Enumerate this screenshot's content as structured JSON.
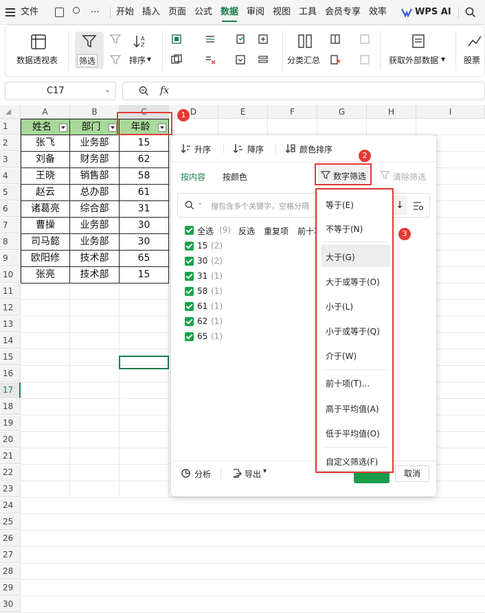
{
  "menubar": {
    "items": [
      "文件",
      "开始",
      "插入",
      "页面",
      "公式",
      "数据",
      "审阅",
      "视图",
      "工具",
      "会员专享",
      "效率"
    ],
    "active": "数据",
    "wps_ai": "WPS AI"
  },
  "ribbon": {
    "pivot": "数据透视表",
    "filter": "筛选",
    "sort": "排序",
    "subtotal": "分类汇总",
    "external": "获取外部数据",
    "stocks": "股票"
  },
  "formula_bar": {
    "cell_ref": "C17",
    "fx": "fx",
    "content": ""
  },
  "sheet": {
    "columns": [
      "A",
      "B",
      "C",
      "D",
      "E",
      "F",
      "G",
      "H",
      "I"
    ],
    "rows": [
      "1",
      "2",
      "3",
      "4",
      "5",
      "6",
      "7",
      "8",
      "9",
      "10",
      "11",
      "12",
      "13",
      "14",
      "15",
      "16",
      "17",
      "18",
      "19",
      "20",
      "21",
      "22",
      "23",
      "24",
      "25",
      "26",
      "27",
      "28",
      "29",
      "30"
    ],
    "header": [
      "姓名",
      "部门",
      "年龄"
    ],
    "data": [
      [
        "张飞",
        "业务部",
        "15"
      ],
      [
        "刘备",
        "财务部",
        "62"
      ],
      [
        "王晓",
        "销售部",
        "58"
      ],
      [
        "赵云",
        "总办部",
        "61"
      ],
      [
        "诸葛亮",
        "综合部",
        "31"
      ],
      [
        "曹操",
        "业务部",
        "30"
      ],
      [
        "司马懿",
        "业务部",
        "30"
      ],
      [
        "欧阳修",
        "技术部",
        "65"
      ],
      [
        "张亮",
        "技术部",
        "15"
      ]
    ]
  },
  "panel": {
    "sort_asc": "升序",
    "sort_desc": "降序",
    "color_sort": "颜色排序",
    "tab_content": "按内容",
    "tab_color": "按颜色",
    "number_filter": "数字筛选",
    "clear_filter": "清除筛选",
    "search_placeholder": "搜包含多个关键字，空格分隔",
    "options": {
      "select_all": "全选",
      "select_all_count": "(9)",
      "invert": "反选",
      "duplicates": "重复项",
      "top10": "前十项"
    },
    "values": [
      {
        "label": "15",
        "count": "(2)"
      },
      {
        "label": "30",
        "count": "(2)"
      },
      {
        "label": "31",
        "count": "(1)"
      },
      {
        "label": "58",
        "count": "(1)"
      },
      {
        "label": "61",
        "count": "(1)"
      },
      {
        "label": "62",
        "count": "(1)"
      },
      {
        "label": "65",
        "count": "(1)"
      }
    ],
    "analyze": "分析",
    "export": "导出",
    "cancel": "取消"
  },
  "number_menu": {
    "items": [
      "等于(E)",
      "不等于(N)",
      "大于(G)",
      "大于或等于(O)",
      "小于(L)",
      "小于或等于(Q)",
      "介于(W)",
      "前十项(T)...",
      "高于平均值(A)",
      "低于平均值(O)",
      "自定义筛选(F)"
    ],
    "highlighted": "大于(G)"
  },
  "badges": [
    "1",
    "2",
    "3"
  ],
  "colors": {
    "accent": "#1a7f4b",
    "header_fill": "#a8d89a",
    "annotation": "#e53935",
    "check": "#16a34a"
  }
}
